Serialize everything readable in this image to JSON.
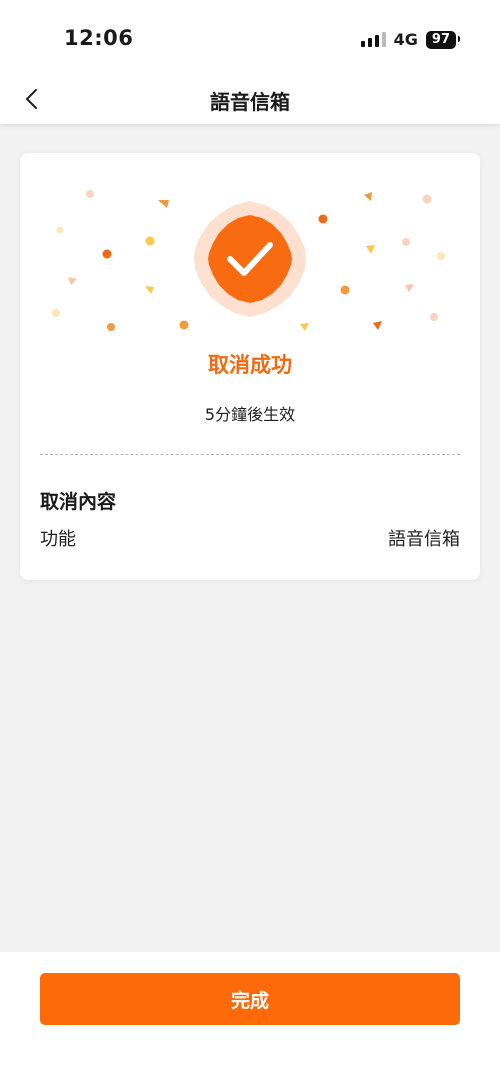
{
  "status_bar": {
    "time": "12:06",
    "network": "4G",
    "battery": "97"
  },
  "nav": {
    "title": "語音信箱",
    "back_icon": "chevron-left-icon"
  },
  "result": {
    "icon": "checkmark-badge-icon",
    "title": "取消成功",
    "subtitle": "5分鐘後生效"
  },
  "details": {
    "section_title": "取消內容",
    "rows": [
      {
        "label": "功能",
        "value": "語音信箱"
      }
    ]
  },
  "footer": {
    "done_label": "完成"
  },
  "colors": {
    "accent": "#fc6a0a",
    "accent_text": "#f06a0f",
    "background": "#f2f2f2"
  }
}
